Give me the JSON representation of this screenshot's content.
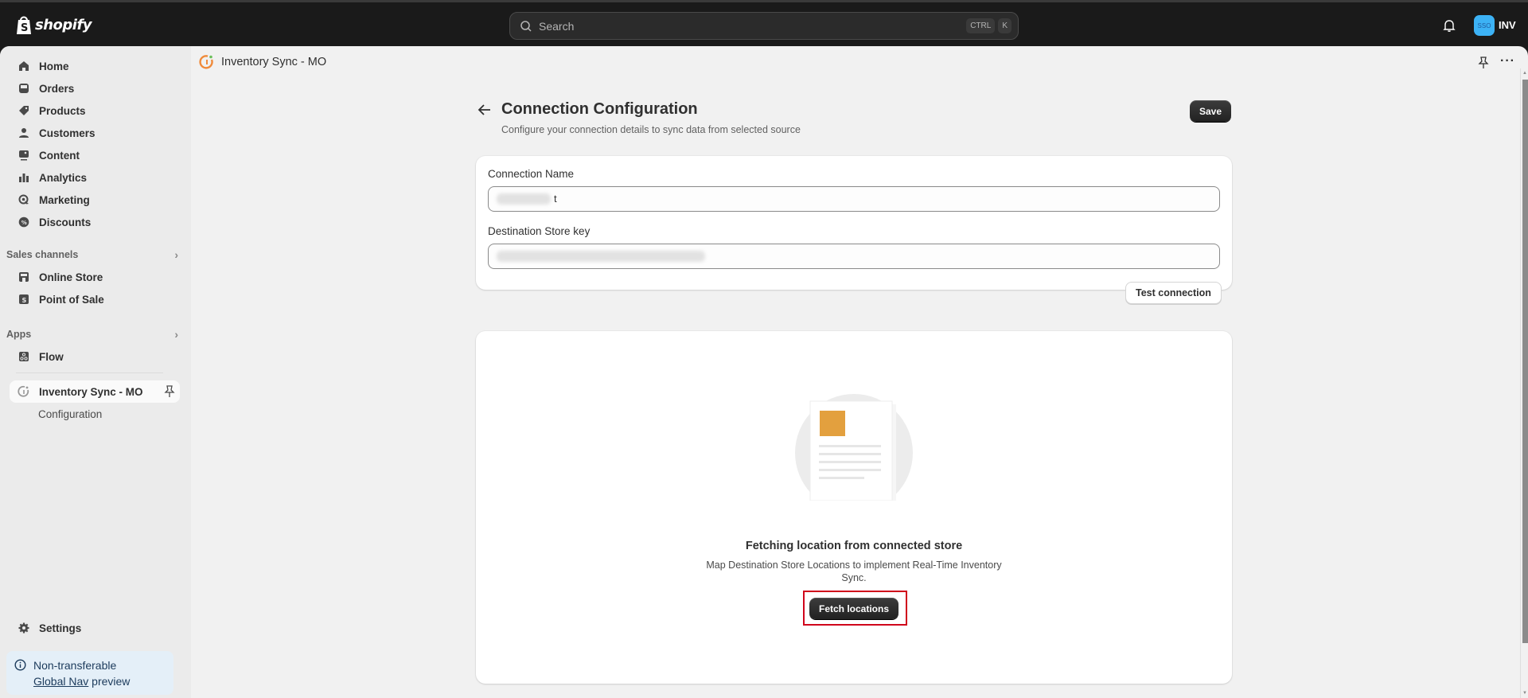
{
  "topbar": {
    "brand": "shopify",
    "search_placeholder": "Search",
    "shortcut_keys": [
      "CTRL",
      "K"
    ],
    "avatar_initials": "SSO",
    "store_name": "INV",
    "colors": {
      "avatar_bg": "#3cb2f5",
      "bar_bg": "#1a1a1a"
    }
  },
  "sidebar": {
    "items": [
      {
        "label": "Home",
        "icon": "home-icon"
      },
      {
        "label": "Orders",
        "icon": "inbox-icon"
      },
      {
        "label": "Products",
        "icon": "tag-icon"
      },
      {
        "label": "Customers",
        "icon": "person-icon"
      },
      {
        "label": "Content",
        "icon": "image-icon"
      },
      {
        "label": "Analytics",
        "icon": "bar-chart-icon"
      },
      {
        "label": "Marketing",
        "icon": "target-icon"
      },
      {
        "label": "Discounts",
        "icon": "discount-icon"
      }
    ],
    "sales_channels": {
      "label": "Sales channels",
      "items": [
        {
          "label": "Online Store",
          "icon": "store-icon"
        },
        {
          "label": "Point of Sale",
          "icon": "pos-icon"
        }
      ]
    },
    "apps": {
      "label": "Apps",
      "items": [
        {
          "label": "Flow",
          "icon": "flow-icon"
        }
      ]
    },
    "pinned_app": {
      "label": "Inventory Sync - MO",
      "sub_items": [
        "Configuration"
      ]
    },
    "settings_label": "Settings",
    "notice": {
      "line1": "Non-transferable",
      "link": "Global Nav",
      "line2_suffix": " preview"
    }
  },
  "app_header": {
    "title": "Inventory Sync - MO"
  },
  "page": {
    "title": "Connection Configuration",
    "subtitle": "Configure your connection details to sync data from selected source",
    "save_label": "Save"
  },
  "connection_form": {
    "connection_name_label": "Connection Name",
    "connection_name_visible_tail": "t",
    "destination_key_label": "Destination Store key",
    "test_button_label": "Test connection"
  },
  "locations_card": {
    "title": "Fetching location from connected store",
    "description": "Map Destination Store Locations to implement Real-Time Inventory Sync.",
    "fetch_button_label": "Fetch locations",
    "highlight_color": "#d0021b"
  }
}
